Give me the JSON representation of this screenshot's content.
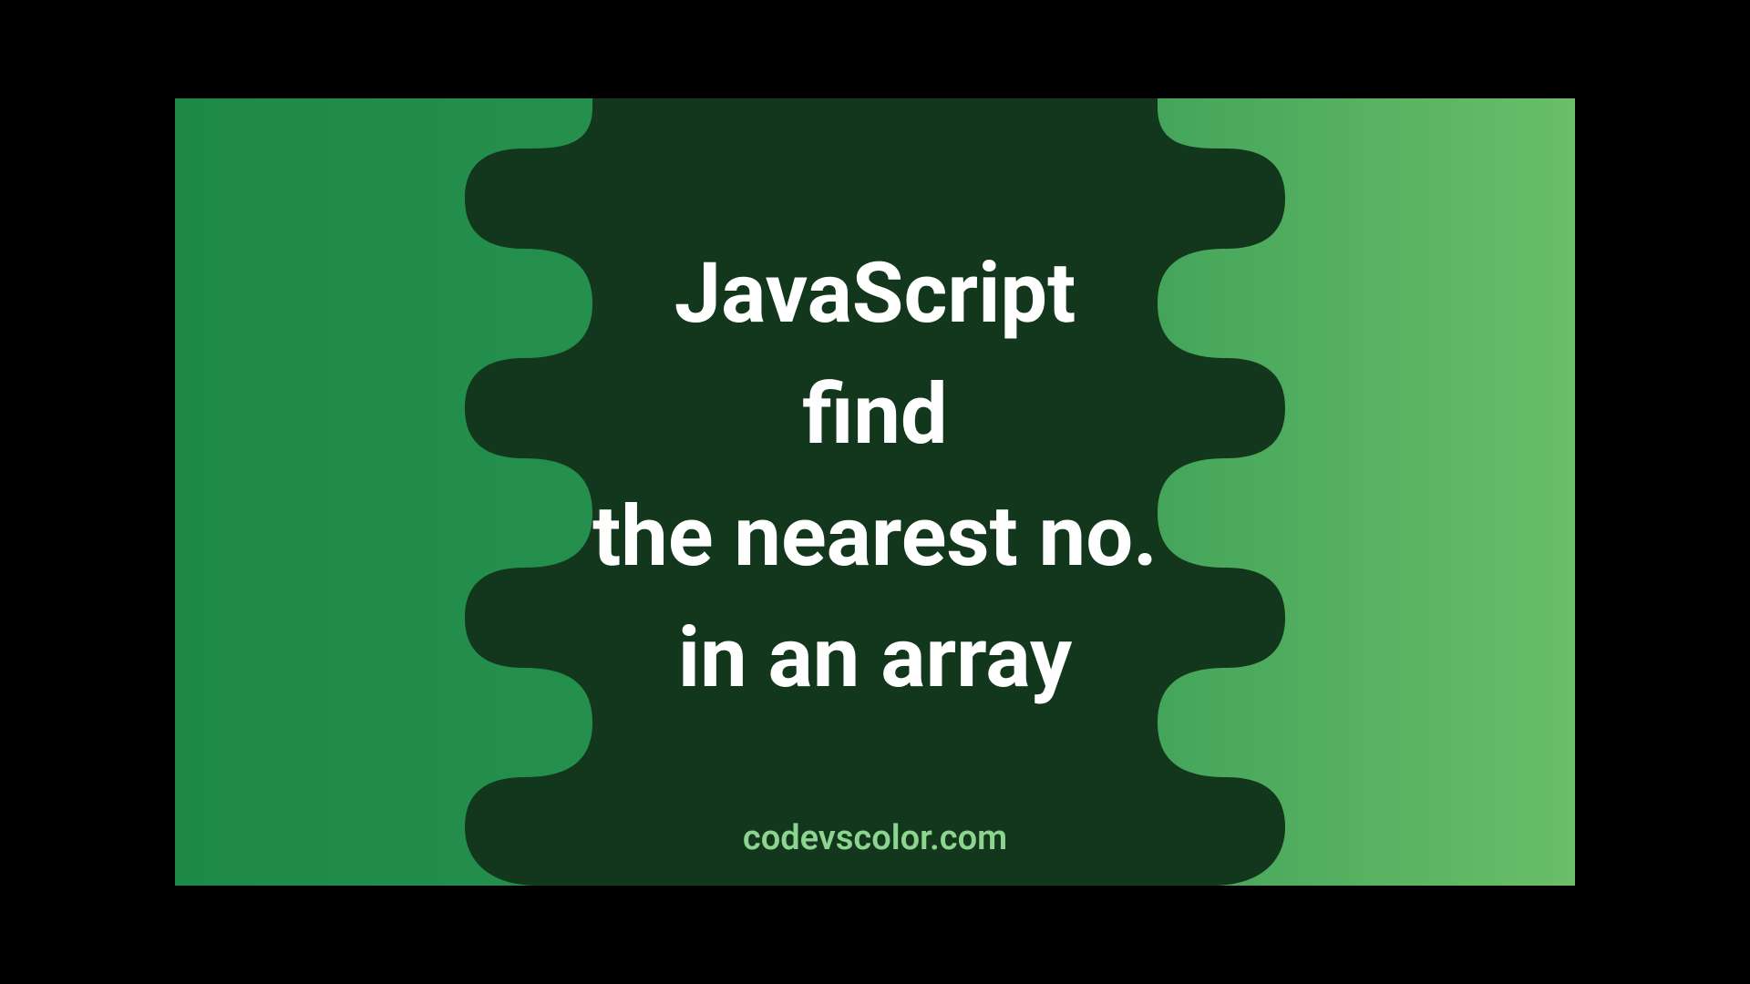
{
  "title_lines": "JavaScript\nfind\nthe nearest no.\nin an array",
  "footer": "codevscolor.com",
  "colors": {
    "blob_fill": "#12371c",
    "text": "#ffffff",
    "footer_text": "#8dd490"
  }
}
